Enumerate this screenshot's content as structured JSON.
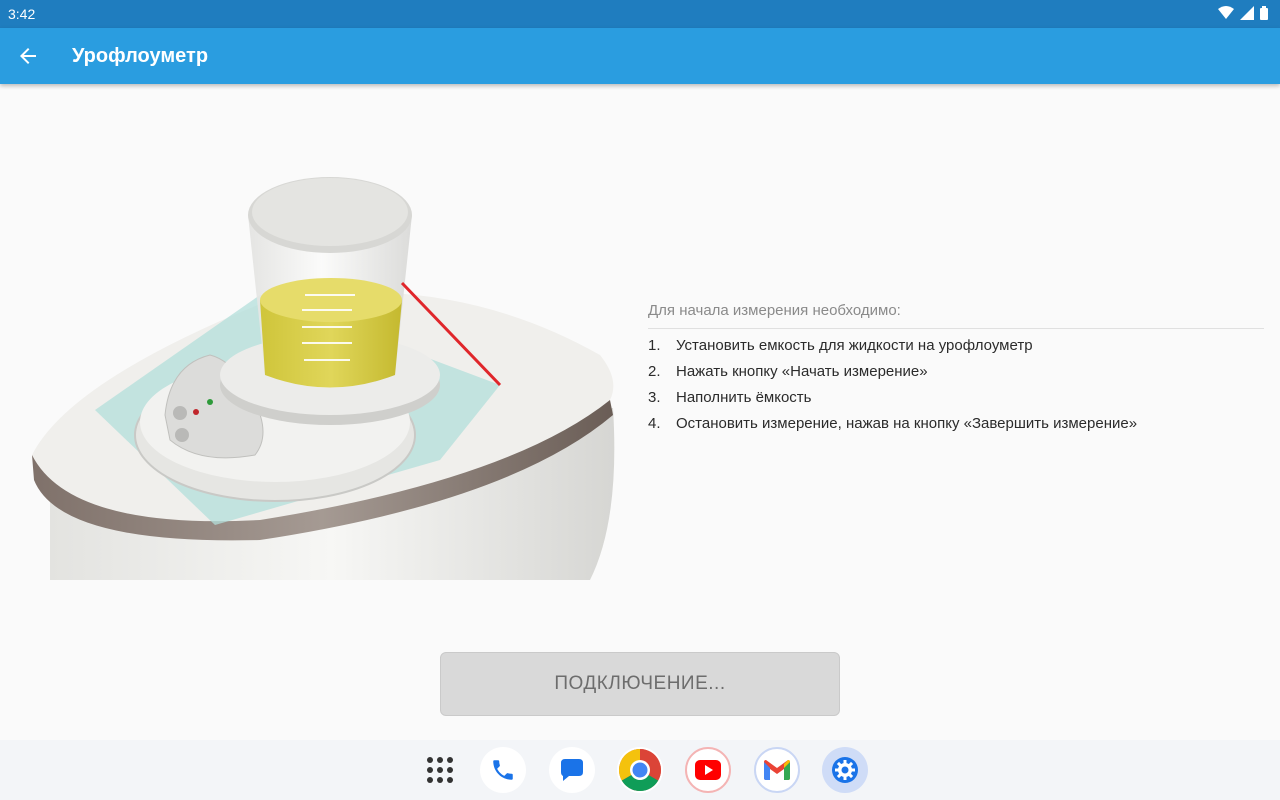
{
  "status_bar": {
    "time": "3:42"
  },
  "app_bar": {
    "title": "Урофлоуметр"
  },
  "instructions": {
    "heading": "Для начала измерения необходимо:",
    "steps": [
      {
        "num": "1.",
        "text": "Установить емкость для жидкости на урофлоуметр"
      },
      {
        "num": "2.",
        "text": "Нажать кнопку «Начать измерение»"
      },
      {
        "num": "3.",
        "text": "Наполнить ёмкость"
      },
      {
        "num": "4.",
        "text": "Остановить измерение, нажав на кнопку «Завершить измерение»"
      }
    ]
  },
  "connect_button": {
    "label": "ПОДКЛЮЧЕНИЕ..."
  },
  "dock": {
    "apps": [
      {
        "icon": "app-drawer-icon"
      },
      {
        "icon": "phone-icon"
      },
      {
        "icon": "messages-icon"
      },
      {
        "icon": "chrome-icon"
      },
      {
        "icon": "youtube-icon"
      },
      {
        "icon": "gmail-icon"
      },
      {
        "icon": "settings-icon"
      }
    ]
  },
  "colors": {
    "status_bar": "#1f7dbf",
    "app_bar": "#2a9de0",
    "button_bg": "#d9d9d9",
    "liquid": "#d8cf45"
  }
}
